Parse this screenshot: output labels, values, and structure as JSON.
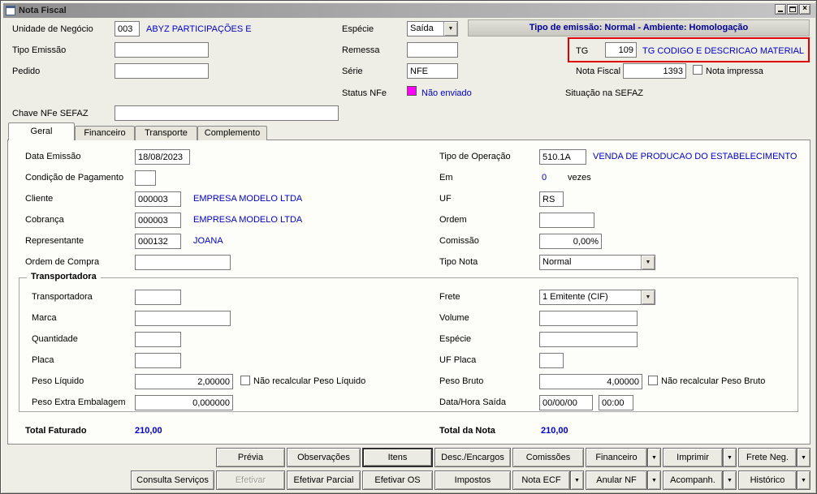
{
  "colors": {
    "value_text": "#0000C8",
    "banner_text": "#000099",
    "status_magenta": "#FF00FF",
    "highlight_red": "#E10000"
  },
  "icons": {
    "dropdown": "▼",
    "close": "×"
  },
  "window": {
    "title": "Nota Fiscal"
  },
  "banner": {
    "text": "Tipo de emissão: Normal - Ambiente: Homologação"
  },
  "header": {
    "unidade": {
      "label": "Unidade de Negócio",
      "value": "003",
      "desc": "ABYZ PARTICIPAÇÕES E"
    },
    "tipo_emissao": {
      "label": "Tipo Emissão",
      "value": ""
    },
    "pedido": {
      "label": "Pedido",
      "value": ""
    },
    "chave": {
      "label": "Chave NFe SEFAZ",
      "value": ""
    },
    "especie": {
      "label": "Espécie",
      "value": "Saída"
    },
    "remessa": {
      "label": "Remessa",
      "value": ""
    },
    "serie": {
      "label": "Série",
      "value": "NFE"
    },
    "status_nfe": {
      "label": "Status NFe",
      "value": "Não enviado"
    },
    "tg": {
      "label": "TG",
      "value": "109",
      "desc": "TG CODIGO E DESCRICAO MATERIAL"
    },
    "nota_fiscal": {
      "label": "Nota Fiscal",
      "value": "1393"
    },
    "nota_impressa": {
      "label": "Nota impressa",
      "checked": false
    },
    "situacao": {
      "label": "Situação na SEFAZ"
    }
  },
  "tabs": [
    {
      "label": "Geral",
      "active": true
    },
    {
      "label": "Financeiro",
      "active": false
    },
    {
      "label": "Transporte",
      "active": false
    },
    {
      "label": "Complemento",
      "active": false
    }
  ],
  "geral": {
    "data_emissao": {
      "label": "Data Emissão",
      "value": "18/08/2023"
    },
    "cond_pagamento": {
      "label": "Condição de Pagamento",
      "value": ""
    },
    "cliente": {
      "label": "Cliente",
      "value": "000003",
      "desc": "EMPRESA MODELO LTDA"
    },
    "cobranca": {
      "label": "Cobrança",
      "value": "000003",
      "desc": "EMPRESA MODELO LTDA"
    },
    "representante": {
      "label": "Representante",
      "value": "000132",
      "desc": "JOANA"
    },
    "ordem_compra": {
      "label": "Ordem de Compra",
      "value": ""
    },
    "tipo_operacao": {
      "label": "Tipo de Operação",
      "value": "510.1A",
      "desc": "VENDA DE PRODUCAO DO ESTABELECIMENTO"
    },
    "em": {
      "label": "Em",
      "value": "0",
      "suffix": "vezes"
    },
    "uf": {
      "label": "UF",
      "value": "RS"
    },
    "ordem": {
      "label": "Ordem",
      "value": ""
    },
    "comissao": {
      "label": "Comissão",
      "value": "0,00%"
    },
    "tipo_nota": {
      "label": "Tipo Nota",
      "value": "Normal"
    }
  },
  "transportadora": {
    "title": "Transportadora",
    "transportadora": {
      "label": "Transportadora",
      "value": ""
    },
    "marca": {
      "label": "Marca",
      "value": ""
    },
    "quantidade": {
      "label": "Quantidade",
      "value": ""
    },
    "placa": {
      "label": "Placa",
      "value": ""
    },
    "peso_liquido": {
      "label": "Peso Líquido",
      "value": "2,00000",
      "check_label": "Não recalcular Peso Líquido",
      "checked": false
    },
    "peso_extra": {
      "label": "Peso Extra Embalagem",
      "value": "0,000000"
    },
    "frete": {
      "label": "Frete",
      "value": "1 Emitente (CIF)"
    },
    "volume": {
      "label": "Volume",
      "value": ""
    },
    "especie": {
      "label": "Espécie",
      "value": ""
    },
    "uf_placa": {
      "label": "UF Placa",
      "value": ""
    },
    "peso_bruto": {
      "label": "Peso Bruto",
      "value": "4,00000",
      "check_label": "Não recalcular Peso Bruto",
      "checked": false
    },
    "data_hora_saida": {
      "label": "Data/Hora Saída",
      "date": "00/00/00",
      "time": "00:00"
    }
  },
  "totais": {
    "faturado": {
      "label": "Total Faturado",
      "value": "210,00"
    },
    "nota": {
      "label": "Total da Nota",
      "value": "210,00"
    }
  },
  "buttons": {
    "row1": [
      {
        "label": "Prévia"
      },
      {
        "label": "Observações"
      },
      {
        "label": "Itens",
        "default": true
      },
      {
        "label": "Desc./Encargos"
      },
      {
        "label": "Comissões"
      },
      {
        "label": "Financeiro",
        "arrow": true
      },
      {
        "label": "Imprimir",
        "arrow": true
      },
      {
        "label": "Frete Neg.",
        "arrow": true
      }
    ],
    "row2": [
      {
        "label": "Consulta Serviços"
      },
      {
        "label": "Efetivar",
        "disabled": true
      },
      {
        "label": "Efetivar Parcial"
      },
      {
        "label": "Efetivar OS"
      },
      {
        "label": "Impostos"
      },
      {
        "label": "Nota ECF",
        "arrow": true
      },
      {
        "label": "Anular NF",
        "arrow": true
      },
      {
        "label": "Acompanh.",
        "arrow": true
      },
      {
        "label": "Histórico",
        "arrow": true
      }
    ]
  }
}
